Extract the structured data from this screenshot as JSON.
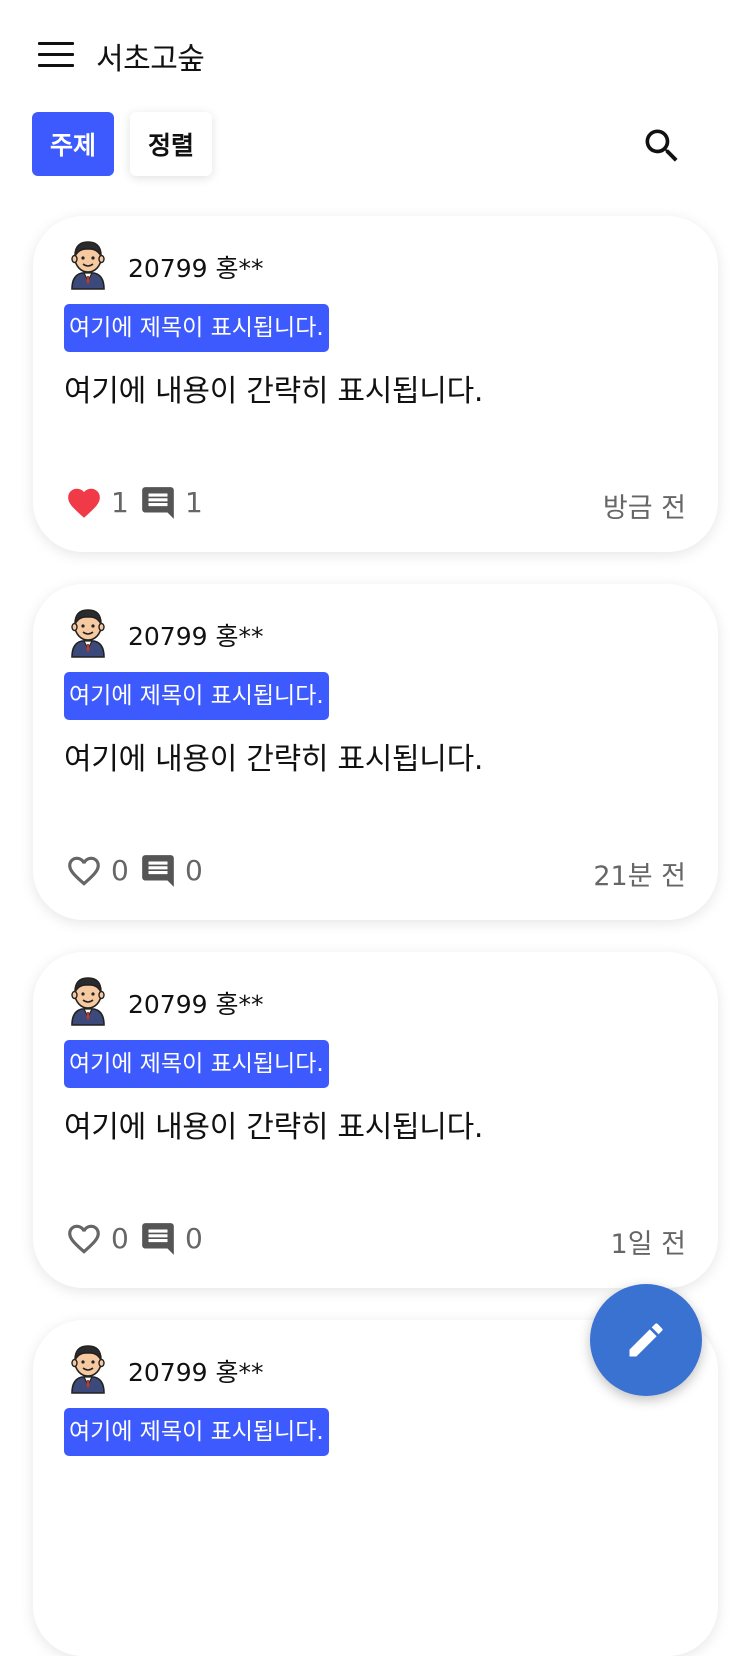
{
  "app": {
    "title": "서초고숲"
  },
  "filters": {
    "topic_label": "주제",
    "sort_label": "정렬"
  },
  "colors": {
    "accent": "#3d5afe",
    "fab": "#3a72d2",
    "like_active": "#f03a47",
    "muted": "#666666"
  },
  "posts": [
    {
      "author": "20799 홍**",
      "title": "여기에 제목이 표시됩니다.",
      "summary": "여기에 내용이 간략히 표시됩니다.",
      "likes": "1",
      "comments": "1",
      "time": "방금 전",
      "liked": true
    },
    {
      "author": "20799 홍**",
      "title": "여기에 제목이 표시됩니다.",
      "summary": "여기에 내용이 간략히 표시됩니다.",
      "likes": "0",
      "comments": "0",
      "time": "21분 전",
      "liked": false
    },
    {
      "author": "20799 홍**",
      "title": "여기에 제목이 표시됩니다.",
      "summary": "여기에 내용이 간략히 표시됩니다.",
      "likes": "0",
      "comments": "0",
      "time": "1일 전",
      "liked": false
    },
    {
      "author": "20799 홍**",
      "title": "여기에 제목이 표시됩니다.",
      "summary": "",
      "likes": "",
      "comments": "",
      "time": "",
      "liked": false
    }
  ],
  "icons": {
    "menu": "menu-icon",
    "search": "search-icon",
    "like_filled": "heart-filled-icon",
    "like_outline": "heart-outline-icon",
    "comment": "comment-icon",
    "avatar": "student-avatar-icon",
    "compose": "pencil-icon"
  }
}
